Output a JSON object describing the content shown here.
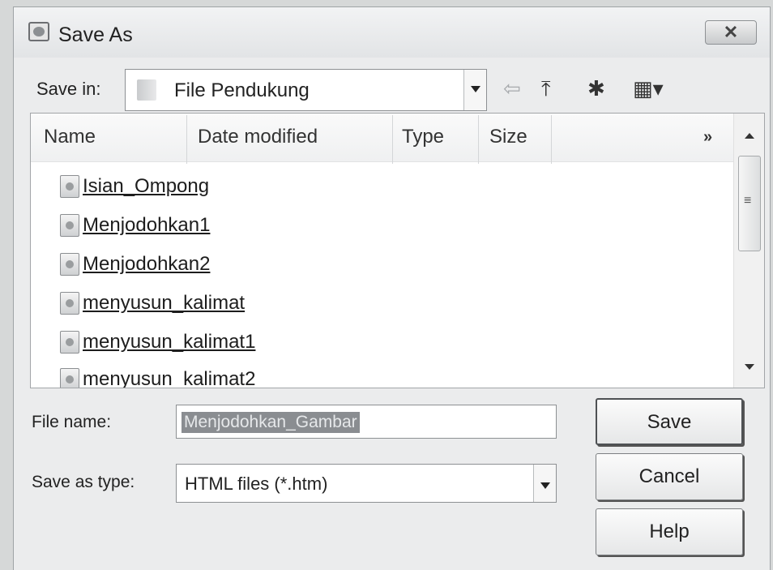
{
  "window": {
    "title": "Save As",
    "close_label": "✕"
  },
  "save_in": {
    "label": "Save in:",
    "value": "File Pendukung"
  },
  "toolbar": {
    "back_icon": "⇦",
    "up_icon": "⤒",
    "new_folder_icon": "✱",
    "view_menu_icon": "▦▾"
  },
  "columns": {
    "name": "Name",
    "date_modified": "Date modified",
    "type": "Type",
    "size": "Size",
    "more": "»"
  },
  "files": [
    {
      "name": "Isian_Ompong"
    },
    {
      "name": "Menjodohkan1"
    },
    {
      "name": "Menjodohkan2"
    },
    {
      "name": "menyusun_kalimat"
    },
    {
      "name": "menyusun_kalimat1"
    },
    {
      "name": "menyusun_kalimat2"
    }
  ],
  "file_name": {
    "label": "File name:",
    "value": "Menjodohkan_Gambar"
  },
  "save_as_type": {
    "label": "Save as type:",
    "value": "HTML files (*.htm)"
  },
  "buttons": {
    "save": "Save",
    "cancel": "Cancel",
    "help": "Help"
  }
}
